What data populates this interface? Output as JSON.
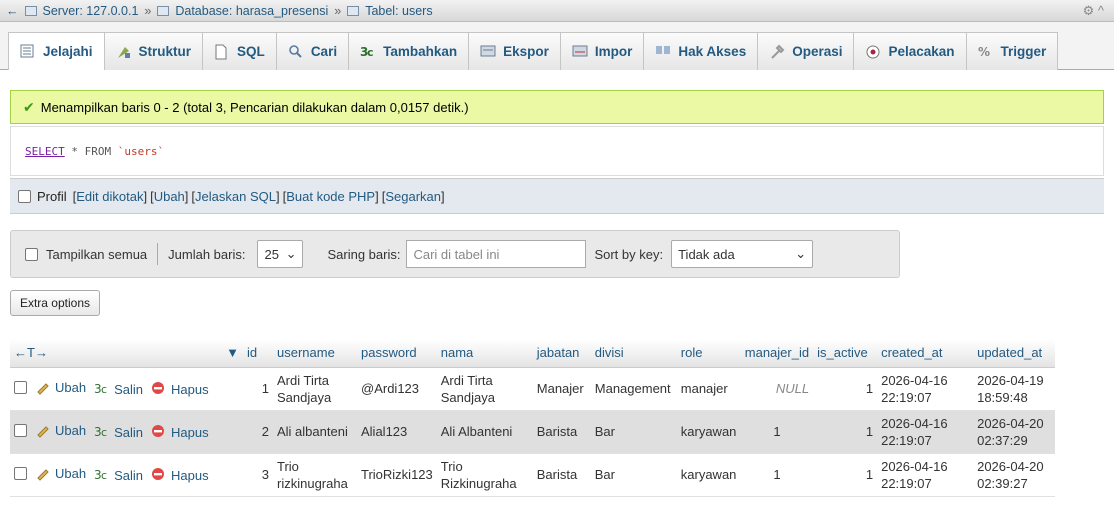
{
  "breadcrumb": {
    "server": "Server: 127.0.0.1",
    "database": "Database: harasa_presensi",
    "table": "Tabel: users",
    "separator": "»"
  },
  "tabs": [
    {
      "label": "Jelajahi",
      "icon": "browse-icon",
      "active": true
    },
    {
      "label": "Struktur",
      "icon": "structure-icon"
    },
    {
      "label": "SQL",
      "icon": "sql-icon"
    },
    {
      "label": "Cari",
      "icon": "search-icon"
    },
    {
      "label": "Tambahkan",
      "icon": "insert-icon"
    },
    {
      "label": "Ekspor",
      "icon": "export-icon"
    },
    {
      "label": "Impor",
      "icon": "import-icon"
    },
    {
      "label": "Hak Akses",
      "icon": "privileges-icon"
    },
    {
      "label": "Operasi",
      "icon": "operations-icon"
    },
    {
      "label": "Pelacakan",
      "icon": "tracking-icon"
    },
    {
      "label": "Trigger",
      "icon": "trigger-icon"
    }
  ],
  "message": {
    "text": "Menampilkan baris 0 - 2 (total 3, Pencarian dilakukan dalam 0,0157 detik.)"
  },
  "sql": {
    "keyword": "SELECT",
    "rest": " * FROM ",
    "table": "`users`"
  },
  "profil": {
    "label": "Profil",
    "links": [
      "Edit dikotak",
      "Ubah",
      "Jelaskan SQL",
      "Buat kode PHP",
      "Segarkan"
    ]
  },
  "nav": {
    "show_all": "Tampilkan semua",
    "rows_label": "Jumlah baris:",
    "rows_value": "25",
    "filter_label": "Saring baris:",
    "filter_placeholder": "Cari di tabel ini",
    "sort_label": "Sort by key:",
    "sort_value": "Tidak ada"
  },
  "extra_options": "Extra options",
  "table": {
    "columns": [
      "id",
      "username",
      "password",
      "nama",
      "jabatan",
      "divisi",
      "role",
      "manajer_id",
      "is_active",
      "created_at",
      "updated_at"
    ],
    "actions": {
      "edit": "Ubah",
      "copy": "Salin",
      "delete": "Hapus"
    },
    "rows": [
      {
        "id": "1",
        "username": "Ardi Tirta Sandjaya",
        "password": "@Ardi123",
        "nama": "Ardi Tirta Sandjaya",
        "jabatan": "Manajer",
        "divisi": "Management",
        "role": "manajer",
        "manajer_id": "NULL",
        "is_active": "1",
        "created_at": "2026-04-16 22:19:07",
        "updated_at": "2026-04-19 18:59:48"
      },
      {
        "id": "2",
        "username": "Ali albanteni",
        "password": "Alial123",
        "nama": "Ali Albanteni",
        "jabatan": "Barista",
        "divisi": "Bar",
        "role": "karyawan",
        "manajer_id": "1",
        "is_active": "1",
        "created_at": "2026-04-16 22:19:07",
        "updated_at": "2026-04-20 02:37:29"
      },
      {
        "id": "3",
        "username": "Trio rizkinugraha",
        "password": "TrioRizki123",
        "nama": "Trio Rizkinugraha",
        "jabatan": "Barista",
        "divisi": "Bar",
        "role": "karyawan",
        "manajer_id": "1",
        "is_active": "1",
        "created_at": "2026-04-16 22:19:07",
        "updated_at": "2026-04-20 02:39:27"
      }
    ]
  },
  "colors": {
    "link": "#235a81",
    "success_bg": "#ebf8a4",
    "profil_bg": "#e3e9ee"
  }
}
